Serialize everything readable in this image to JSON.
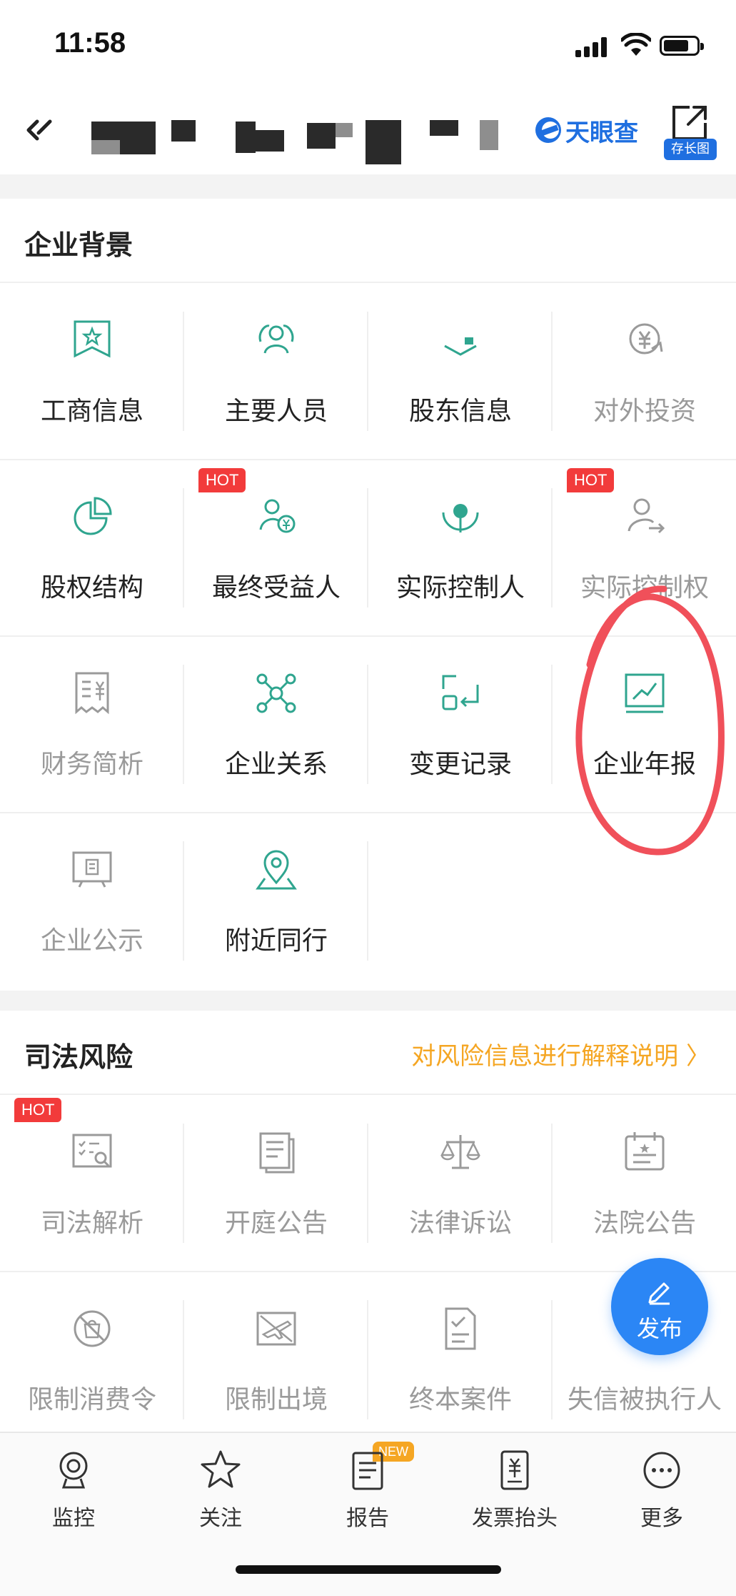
{
  "status": {
    "time": "11:58"
  },
  "header": {
    "logo_text": "天眼查",
    "share_tag": "存长图"
  },
  "colors": {
    "accent_green": "#2fa58f",
    "inactive_gray": "#9a9a9a",
    "hot_red": "#f23b3b",
    "link_orange": "#f5a623",
    "brand_blue": "#1f6fe0"
  },
  "background_section": {
    "title": "企业背景",
    "items": [
      {
        "label": "工商信息",
        "icon": "certificate-icon",
        "active": true
      },
      {
        "label": "主要人员",
        "icon": "people-icon",
        "active": true
      },
      {
        "label": "股东信息",
        "icon": "shareholder-icon",
        "active": true
      },
      {
        "label": "对外投资",
        "icon": "investment-icon",
        "active": false
      },
      {
        "label": "股权结构",
        "icon": "pie-chart-icon",
        "active": true
      },
      {
        "label": "最终受益人",
        "icon": "beneficiary-icon",
        "active": true,
        "badge": "HOT"
      },
      {
        "label": "实际控制人",
        "icon": "controller-icon",
        "active": true
      },
      {
        "label": "实际控制权",
        "icon": "control-right-icon",
        "active": false,
        "badge": "HOT"
      },
      {
        "label": "财务简析",
        "icon": "finance-receipt-icon",
        "active": false
      },
      {
        "label": "企业关系",
        "icon": "network-icon",
        "active": true
      },
      {
        "label": "变更记录",
        "icon": "change-record-icon",
        "active": true
      },
      {
        "label": "企业年报",
        "icon": "annual-report-chart-icon",
        "active": true
      },
      {
        "label": "企业公示",
        "icon": "public-notice-icon",
        "active": false
      },
      {
        "label": "附近同行",
        "icon": "location-pin-icon",
        "active": true
      }
    ]
  },
  "risk_section": {
    "title": "司法风险",
    "link": "对风险信息进行解释说明 〉",
    "items": [
      {
        "label": "司法解析",
        "icon": "judicial-analysis-icon",
        "active": false,
        "badge": "HOT"
      },
      {
        "label": "开庭公告",
        "icon": "court-notice-icon",
        "active": false
      },
      {
        "label": "法律诉讼",
        "icon": "scales-icon",
        "active": false
      },
      {
        "label": "法院公告",
        "icon": "court-announcement-icon",
        "active": false
      },
      {
        "label": "限制消费令",
        "icon": "no-consumption-icon",
        "active": false
      },
      {
        "label": "限制出境",
        "icon": "no-exit-icon",
        "active": false
      },
      {
        "label": "终本案件",
        "icon": "terminated-case-icon",
        "active": false
      },
      {
        "label": "失信被执行人",
        "icon": "dishonest-person-icon",
        "active": false
      }
    ]
  },
  "fab": {
    "label": "发布"
  },
  "tabbar": {
    "items": [
      {
        "label": "监控",
        "icon": "monitor-camera-icon"
      },
      {
        "label": "关注",
        "icon": "star-icon"
      },
      {
        "label": "报告",
        "icon": "report-icon",
        "badge": "NEW"
      },
      {
        "label": "发票抬头",
        "icon": "invoice-icon"
      },
      {
        "label": "更多",
        "icon": "more-icon"
      }
    ]
  }
}
